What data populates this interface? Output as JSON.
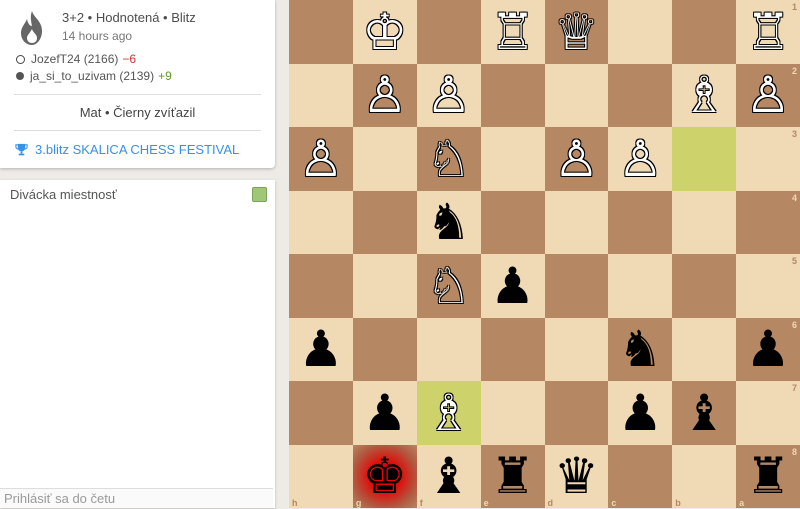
{
  "game": {
    "setup_title": "3+2 • Hodnotená • Blitz",
    "time_ago": "14 hours ago",
    "icon": "flame-icon",
    "players": [
      {
        "color": "white",
        "name": "JozefT24 (2166)",
        "diff": "−6"
      },
      {
        "color": "black",
        "name": "ja_si_to_uzivam (2139)",
        "diff": "+9"
      }
    ],
    "status": "Mat • Čierny zvíťazil",
    "tournament": "3.blitz SKALICA CHESS FESTIVAL",
    "tournament_icon": "trophy-icon"
  },
  "chat": {
    "title": "Divácka miestnosť",
    "input_placeholder": "Prihlásiť sa do četu"
  },
  "board": {
    "orientation": "black",
    "ranks": [
      "1",
      "2",
      "3",
      "4",
      "5",
      "6",
      "7",
      "8"
    ],
    "files": [
      "h",
      "g",
      "f",
      "e",
      "d",
      "c",
      "b",
      "a"
    ],
    "highlight_squares": [
      "b3",
      "f7"
    ],
    "check_square": "g8",
    "colors": {
      "light": "#f0d9b5",
      "dark": "#b58863",
      "highlight": "#cdd26a",
      "check": "#e70000"
    },
    "pieces": [
      {
        "sq": "g1",
        "piece": "K",
        "color": "w"
      },
      {
        "sq": "e1",
        "piece": "R",
        "color": "w"
      },
      {
        "sq": "d1",
        "piece": "Q",
        "color": "w"
      },
      {
        "sq": "a1",
        "piece": "R",
        "color": "w"
      },
      {
        "sq": "g2",
        "piece": "P",
        "color": "w"
      },
      {
        "sq": "f2",
        "piece": "P",
        "color": "w"
      },
      {
        "sq": "b2",
        "piece": "B",
        "color": "w"
      },
      {
        "sq": "a2",
        "piece": "P",
        "color": "w"
      },
      {
        "sq": "h3",
        "piece": "P",
        "color": "w"
      },
      {
        "sq": "f3",
        "piece": "N",
        "color": "w"
      },
      {
        "sq": "d3",
        "piece": "P",
        "color": "w"
      },
      {
        "sq": "c3",
        "piece": "P",
        "color": "w"
      },
      {
        "sq": "f4",
        "piece": "N",
        "color": "b"
      },
      {
        "sq": "f5",
        "piece": "N",
        "color": "w"
      },
      {
        "sq": "e5",
        "piece": "P",
        "color": "b"
      },
      {
        "sq": "h6",
        "piece": "P",
        "color": "b"
      },
      {
        "sq": "c6",
        "piece": "N",
        "color": "b"
      },
      {
        "sq": "a6",
        "piece": "P",
        "color": "b"
      },
      {
        "sq": "g7",
        "piece": "P",
        "color": "b"
      },
      {
        "sq": "f7",
        "piece": "B",
        "color": "w"
      },
      {
        "sq": "c7",
        "piece": "P",
        "color": "b"
      },
      {
        "sq": "b7",
        "piece": "B",
        "color": "b"
      },
      {
        "sq": "g8",
        "piece": "K",
        "color": "b"
      },
      {
        "sq": "f8",
        "piece": "B",
        "color": "b"
      },
      {
        "sq": "e8",
        "piece": "R",
        "color": "b"
      },
      {
        "sq": "d8",
        "piece": "Q",
        "color": "b"
      },
      {
        "sq": "a8",
        "piece": "R",
        "color": "b"
      }
    ]
  }
}
